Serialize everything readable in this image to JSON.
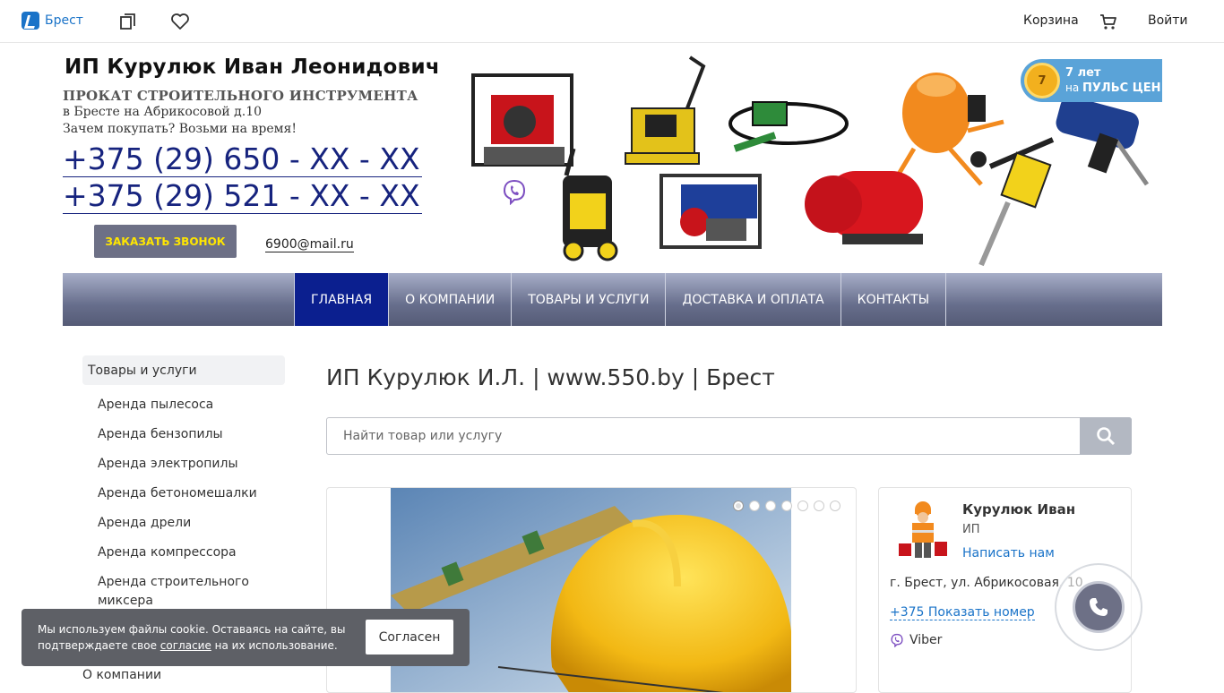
{
  "topbar": {
    "city": "Брест",
    "icons": [
      "compare-icon",
      "heart-icon",
      "cart-icon"
    ],
    "cart_label": "Корзина",
    "login_label": "Войти",
    "accent": "#1a73c8"
  },
  "banner": {
    "company_title": "ИП Курулюк Иван Леонидович",
    "tagline_1": "ПРОКАТ СТРОИТЕЛЬНОГО ИНСТРУМЕНТА",
    "tagline_2": "в Бресте на Абрикосовой д.10",
    "tagline_3": "Зачем покупать? Возьми на время!",
    "phone_1": "+375 (29) 650 - XX - XX",
    "phone_2": "+375 (29) 521 - XX - XX",
    "call_button": "ЗАКАЗАТЬ ЗВОНОК",
    "email": "6900@mail.ru",
    "badge_years": "7 лет",
    "badge_on": "на",
    "badge_site": "ПУЛЬС ЦЕН",
    "badge_medal": "7"
  },
  "nav": {
    "items": [
      "ГЛАВНАЯ",
      "О КОМПАНИИ",
      "ТОВАРЫ И УСЛУГИ",
      "ДОСТАВКА И ОПЛАТА",
      "КОНТАКТЫ"
    ],
    "active_index": 0,
    "active_color": "#0b1f8f"
  },
  "sidebar": {
    "header": "Товары и услуги",
    "items": [
      "Аренда пылесоса",
      "Аренда бензопилы",
      "Аренда электропилы",
      "Аренда бетономешалки",
      "Аренда дрели",
      "Аренда компрессора",
      "Аренда строительного миксера"
    ],
    "about": "О компании"
  },
  "main": {
    "title": "ИП Курулюк И.Л. | www.550.by | Брест",
    "search_placeholder": "Найти товар или услугу",
    "slider_dots": 7,
    "slider_active": 0
  },
  "card": {
    "name": "Курулюк Иван",
    "role": "ИП",
    "write": "Написать нам",
    "address": "г. Брест, ул. Абрикосовая, 10",
    "show_phone": "+375 Показать номер",
    "viber": "Viber"
  },
  "cookie": {
    "text_before": "Мы используем файлы cookie. Оставаясь на сайте, вы подтверждаете свое ",
    "link": "согласие",
    "text_after": " на их использование.",
    "button": "Согласен"
  }
}
